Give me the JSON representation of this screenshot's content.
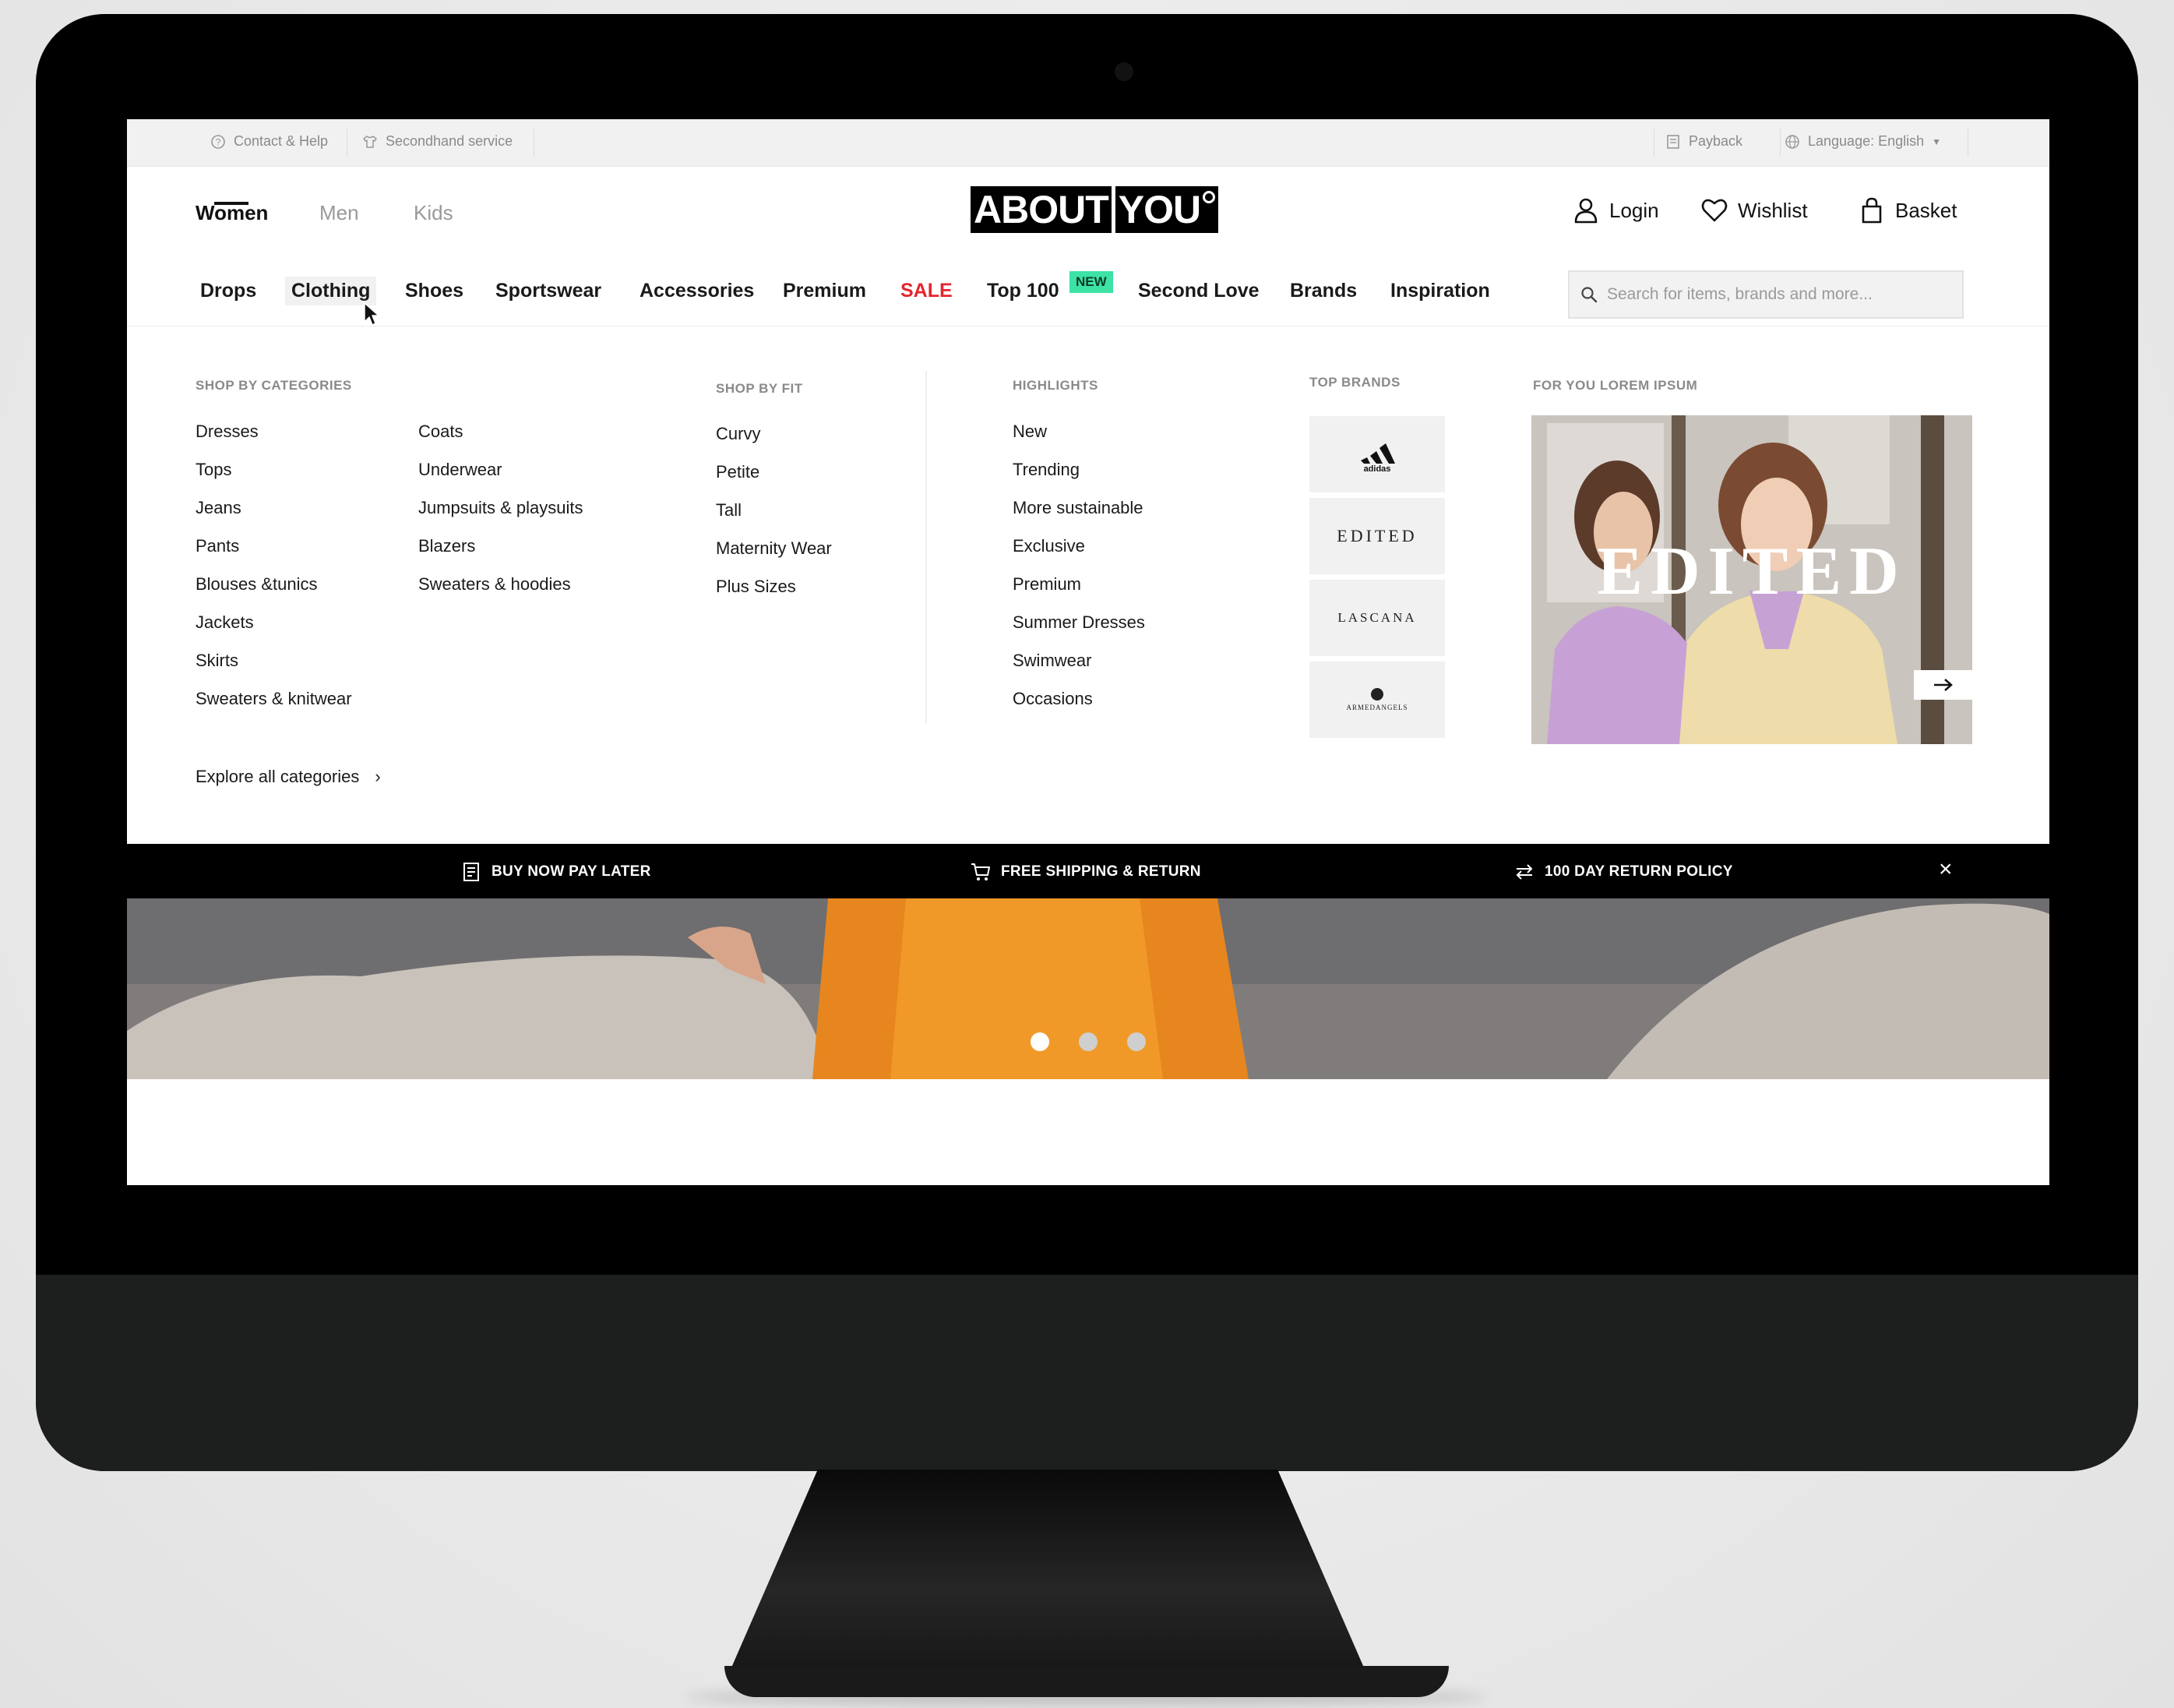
{
  "topbar": {
    "contact_help": "Contact & Help",
    "secondhand": "Secondhand service",
    "payback": "Payback",
    "language": "Language: English"
  },
  "header": {
    "genders": [
      "Women",
      "Men",
      "Kids"
    ],
    "logo_text": [
      "ABOUT",
      "YOU"
    ],
    "login": "Login",
    "wishlist": "Wishlist",
    "basket": "Basket"
  },
  "nav": {
    "items": [
      "Drops",
      "Clothing",
      "Shoes",
      "Sportswear",
      "Accessories",
      "Premium",
      "SALE",
      "Top 100",
      "Second Love",
      "Brands",
      "Inspiration"
    ],
    "new_badge": "NEW",
    "search_placeholder": "Search for items, brands and more..."
  },
  "menu": {
    "shop_by_categories": {
      "title": "SHOP BY CATEGORIES",
      "col1": [
        "Dresses",
        "Tops",
        "Jeans",
        "Pants",
        "Blouses &tunics",
        "Jackets",
        "Skirts",
        "Sweaters & knitwear"
      ],
      "col2": [
        "Coats",
        "Underwear",
        "Jumpsuits & playsuits",
        "Blazers",
        "Sweaters & hoodies"
      ]
    },
    "shop_by_fit": {
      "title": "SHOP BY FIT",
      "items": [
        "Curvy",
        "Petite",
        "Tall",
        "Maternity Wear",
        "Plus Sizes"
      ]
    },
    "highlights": {
      "title": "HIGHLIGHTS",
      "items": [
        "New",
        "Trending",
        "More sustainable",
        "Exclusive",
        "Premium",
        "Summer Dresses",
        "Swimwear",
        "Occasions"
      ]
    },
    "top_brands": {
      "title": "TOP BRANDS",
      "items": [
        "adidas",
        "EDITED",
        "LASCANA",
        "ARMEDANGELS"
      ]
    },
    "for_you": {
      "title": "FOR YOU LOREM IPSUM",
      "promo_title": "EDITED"
    },
    "explore_all": "Explore all categories"
  },
  "benefits": {
    "items": [
      "BUY NOW PAY LATER",
      "FREE SHIPPING & RETURN",
      "100 DAY RETURN POLICY"
    ]
  },
  "colors": {
    "accent_sale": "#e3262f",
    "new_badge": "#3ce3a5"
  },
  "carousel": {
    "slides": 3,
    "active": 1
  }
}
